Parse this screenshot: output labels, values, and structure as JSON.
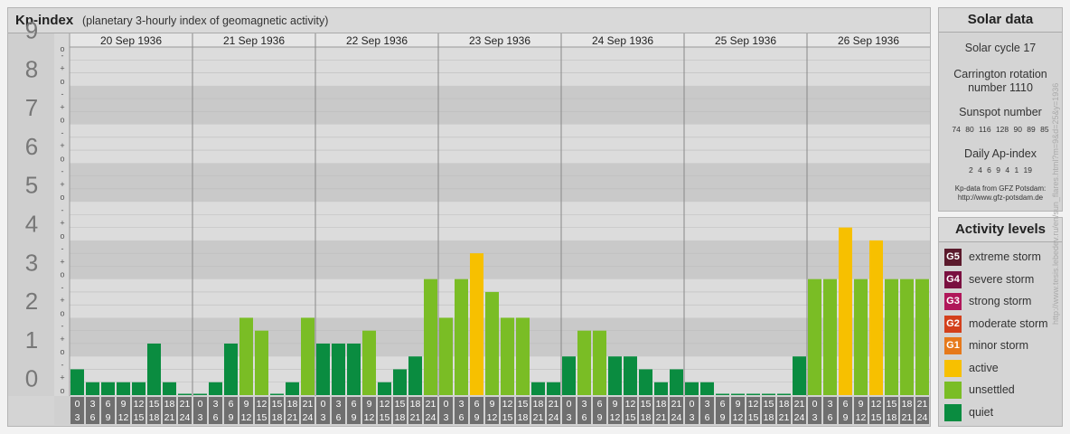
{
  "header": {
    "title": "Kp-index",
    "subtitle": "(planetary 3-hourly index of geomagnetic activity)"
  },
  "chart_data": {
    "type": "bar",
    "ylim": [
      0,
      9
    ],
    "y_ticks": [
      "0",
      "1",
      "2",
      "3",
      "4",
      "5",
      "6",
      "7",
      "8",
      "9"
    ],
    "subticks": [
      "o",
      "-",
      "+"
    ],
    "days": [
      "20 Sep 1936",
      "21 Sep 1936",
      "22 Sep 1936",
      "23 Sep 1936",
      "24 Sep 1936",
      "25 Sep 1936",
      "26 Sep 1936"
    ],
    "interval_start": [
      "0",
      "3",
      "6",
      "9",
      "12",
      "15",
      "18",
      "21"
    ],
    "interval_end": [
      "3",
      "6",
      "9",
      "12",
      "15",
      "18",
      "21",
      "24"
    ],
    "values": [
      [
        0.667,
        0.333,
        0.333,
        0.333,
        0.333,
        1.333,
        0.333,
        0
      ],
      [
        0,
        0.333,
        1.333,
        2.0,
        1.667,
        0,
        0.333,
        2.0
      ],
      [
        1.333,
        1.333,
        1.333,
        1.667,
        0.333,
        0.667,
        1.0,
        3.0
      ],
      [
        2.0,
        3.0,
        3.667,
        2.667,
        2.0,
        2.0,
        0.333,
        0.333
      ],
      [
        1.0,
        1.667,
        1.667,
        1.0,
        1.0,
        0.667,
        0.333,
        0.667
      ],
      [
        0.333,
        0.333,
        0,
        0,
        0,
        0,
        0,
        1.0
      ],
      [
        3.0,
        3.0,
        4.333,
        3.0,
        4.0,
        3.0,
        3.0,
        3.0
      ]
    ]
  },
  "solar_data": {
    "title": "Solar data",
    "cycle": "Solar cycle 17",
    "carrington_line1": "Carrington rotation",
    "carrington_line2": "number 1110",
    "sunspot_label": "Sunspot number",
    "sunspot_values": "74 80 116 128 90 89 85",
    "ap_label": "Daily Ap-index",
    "ap_values": "2 4 6 9 4 1 19",
    "source_line1": "Kp-data from GFZ Potsdam:",
    "source_line2": "http://www.gfz-potsdam.de"
  },
  "activity_levels": {
    "title": "Activity levels",
    "items": [
      {
        "code": "G5",
        "label": "extreme storm",
        "color": "#5b1a2c"
      },
      {
        "code": "G4",
        "label": "severe storm",
        "color": "#7a1040"
      },
      {
        "code": "G3",
        "label": "strong storm",
        "color": "#b0175a"
      },
      {
        "code": "G2",
        "label": "moderate storm",
        "color": "#d3401c"
      },
      {
        "code": "G1",
        "label": "minor storm",
        "color": "#e6791b"
      },
      {
        "code": "",
        "label": "active",
        "color": "#f7c000"
      },
      {
        "code": "",
        "label": "unsettled",
        "color": "#7abd25"
      },
      {
        "code": "",
        "label": "quiet",
        "color": "#0a8c40"
      }
    ]
  },
  "watermark": "http://www.tesis.lebedev.ru/en/sun_flares.html?m=9&d=25&y=1936"
}
